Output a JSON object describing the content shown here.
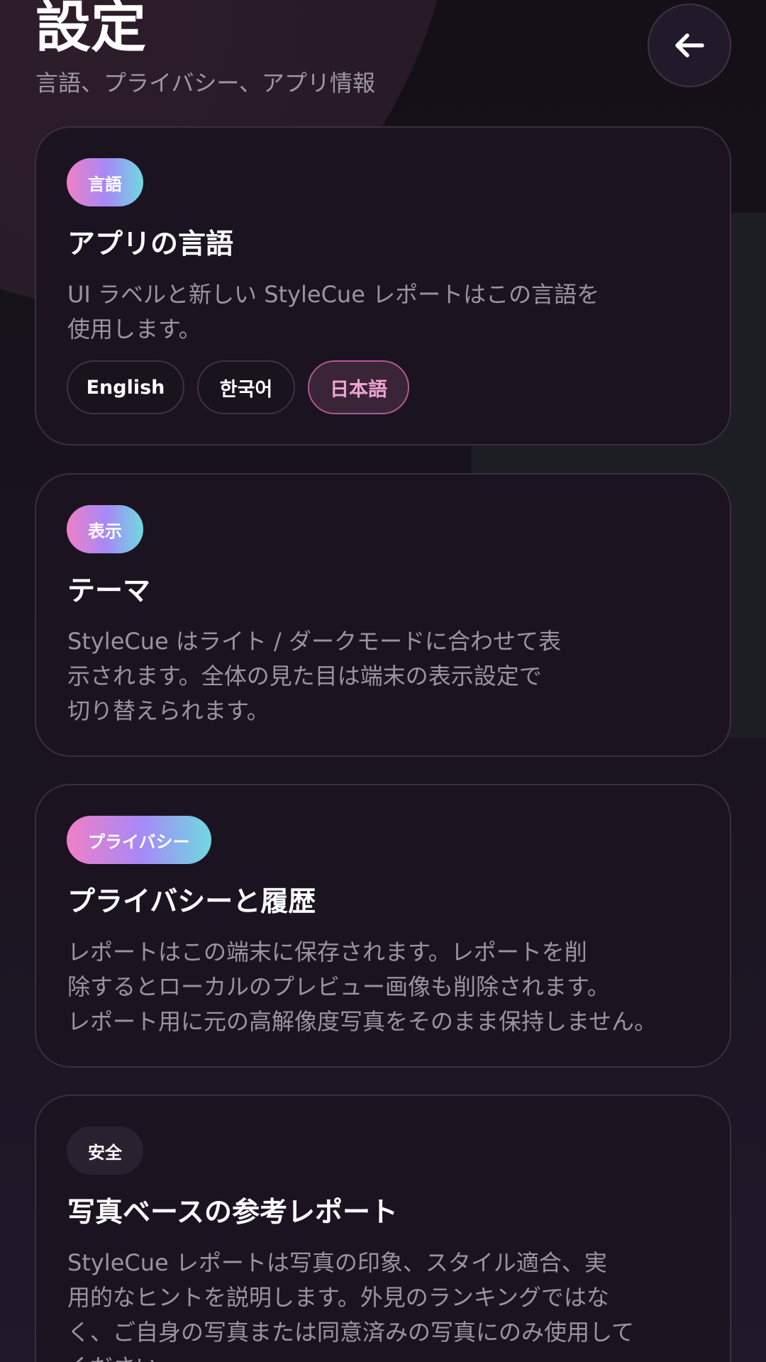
{
  "header": {
    "title": "設定",
    "subtitle": "言語、プライバシー、アプリ情報",
    "back_icon": "arrow-left-icon"
  },
  "cards": {
    "language": {
      "badge": "言語",
      "title": "アプリの言語",
      "description_lines": [
        "UI ラベルと新しい StyleCue レポートはこの言語を",
        "使用します。"
      ],
      "options": [
        "English",
        "한국어",
        "日本語"
      ],
      "selected_option": "日本語"
    },
    "display": {
      "badge": "表示",
      "title": "テーマ",
      "description_lines": [
        "StyleCue はライト / ダークモードに合わせて表",
        "示されます。全体の見た目は端末の表示設定で",
        "切り替えられます。"
      ]
    },
    "privacy": {
      "badge": "プライバシー",
      "title": "プライバシーと履歴",
      "description_lines": [
        "レポートはこの端末に保存されます。レポートを削",
        "除するとローカルのプレビュー画像も削除されます。",
        "レポート用に元の高解像度写真をそのまま保持しません。"
      ]
    },
    "safety": {
      "badge": "安全",
      "title": "写真ベースの参考レポート",
      "description_lines": [
        "StyleCue レポートは写真の印象、スタイル適合、実",
        "用的なヒントを説明します。外見のランキングではな",
        "く、ご自身の写真または同意済みの写真にのみ使用して",
        "ください。"
      ]
    }
  },
  "colors": {
    "background": "#17121b",
    "card": "#1b1420",
    "accent_pink": "#ef7fc6",
    "accent_purple": "#a689f7",
    "accent_cyan": "#6fd9e1",
    "selected_text": "#f0a4d3"
  }
}
